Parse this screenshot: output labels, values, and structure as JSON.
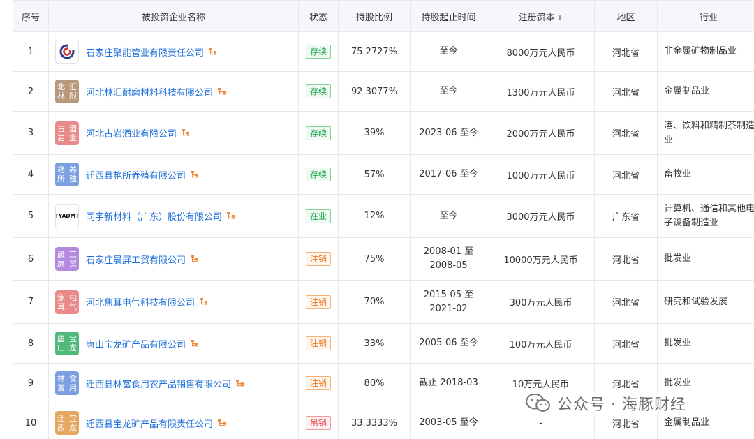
{
  "headers": {
    "index": "序号",
    "name": "被投资企业名称",
    "status": "状态",
    "ratio": "持股比例",
    "period": "持股起止时间",
    "capital": "注册资本",
    "region": "地区",
    "industry": "行业"
  },
  "rows": [
    {
      "index": "1",
      "logo_type": "img",
      "logo": "",
      "name": "石家庄聚能管业有限责任公司",
      "status": "存续",
      "status_color": "green",
      "ratio": "75.2727%",
      "period1": "至今",
      "period2": "",
      "capital": "8000万元人民币",
      "region": "河北省",
      "industry": "非金属矿物制品业",
      "logo_color": "#ffffff"
    },
    {
      "index": "2",
      "logo_type": "text",
      "logo": "北林\n汇耐",
      "name": "河北林汇耐磨材料科技有限公司",
      "status": "存续",
      "status_color": "green",
      "ratio": "92.3077%",
      "period1": "至今",
      "period2": "",
      "capital": "1300万元人民币",
      "region": "河北省",
      "industry": "金属制品业",
      "logo_color": "#b8977a"
    },
    {
      "index": "3",
      "logo_type": "text",
      "logo": "古岩\n酒业",
      "name": "河北古岩酒业有限公司",
      "status": "存续",
      "status_color": "green",
      "ratio": "39%",
      "period1": "2023-06 至今",
      "period2": "",
      "capital": "2000万元人民币",
      "region": "河北省",
      "industry": "酒、饮料和精制茶制造业",
      "logo_color": "#e98a8a"
    },
    {
      "index": "4",
      "logo_type": "text",
      "logo": "艳所\n养殖",
      "name": "迁西县艳所养殖有限公司",
      "status": "存续",
      "status_color": "green",
      "ratio": "57%",
      "period1": "2017-06 至今",
      "period2": "",
      "capital": "1000万元人民币",
      "region": "河北省",
      "industry": "畜牧业",
      "logo_color": "#7b9fe0"
    },
    {
      "index": "5",
      "logo_type": "tya",
      "logo": "TYADMT",
      "name": "同宇新材料（广东）股份有限公司",
      "status": "在业",
      "status_color": "green",
      "ratio": "12%",
      "period1": "至今",
      "period2": "",
      "capital": "3000万元人民币",
      "region": "广东省",
      "industry": "计算机、通信和其他电子设备制造业",
      "logo_color": "#ffffff"
    },
    {
      "index": "6",
      "logo_type": "text",
      "logo": "晨屏\n工贸",
      "name": "石家庄晨屏工贸有限公司",
      "status": "注销",
      "status_color": "orange",
      "ratio": "75%",
      "period1": "2008-01 至",
      "period2": "2008-05",
      "capital": "10000万元人民币",
      "region": "河北省",
      "industry": "批发业",
      "logo_color": "#b48ae0"
    },
    {
      "index": "7",
      "logo_type": "text",
      "logo": "焦耳\n电气",
      "name": "河北焦耳电气科技有限公司",
      "status": "注销",
      "status_color": "orange",
      "ratio": "70%",
      "period1": "2015-05 至",
      "period2": "2021-02",
      "capital": "300万元人民币",
      "region": "河北省",
      "industry": "研究和试验发展",
      "logo_color": "#e98a8a"
    },
    {
      "index": "8",
      "logo_type": "text",
      "logo": "唐山\n宝龙",
      "name": "唐山宝龙矿产品有限公司",
      "status": "注销",
      "status_color": "orange",
      "ratio": "33%",
      "period1": "2005-06 至今",
      "period2": "",
      "capital": "100万元人民币",
      "region": "河北省",
      "industry": "批发业",
      "logo_color": "#4fb87a"
    },
    {
      "index": "9",
      "logo_type": "text",
      "logo": "林富\n食用",
      "name": "迁西县林富食用农产品销售有限公司",
      "status": "注销",
      "status_color": "orange",
      "ratio": "80%",
      "period1": "截止 2018-03",
      "period2": "",
      "capital": "10万元人民币",
      "region": "河北省",
      "industry": "批发业",
      "logo_color": "#7b9fe0"
    },
    {
      "index": "10",
      "logo_type": "text",
      "logo": "迁西\n宝龙",
      "name": "迁西县宝龙矿产品有限责任公司",
      "status": "吊销",
      "status_color": "red",
      "ratio": "33.3333%",
      "period1": "2003-05 至今",
      "period2": "",
      "capital": "-",
      "region": "河北省",
      "industry": "金属制品业",
      "logo_color": "#e5a660"
    }
  ],
  "watermark": "公众号 · 海豚财经"
}
